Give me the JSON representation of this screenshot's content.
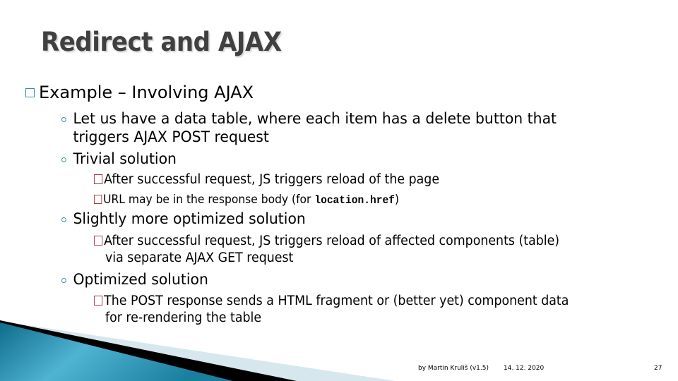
{
  "slide": {
    "title": "Redirect and AJAX",
    "level1": {
      "text": "Example – Involving AJAX"
    },
    "items": {
      "i1": {
        "line1": "Let us have a data table, where each item has a delete button that",
        "line2": "triggers AJAX POST request"
      },
      "i2": {
        "text": "Trivial solution",
        "sub1": "After successful request, JS triggers reload of the page",
        "sub1a_prefix": "URL may be in the response body (for ",
        "sub1a_code": "location.href",
        "sub1a_suffix": ")"
      },
      "i3": {
        "text": "Slightly more optimized solution",
        "sub1_line1": "After successful request, JS triggers reload of affected components (table)",
        "sub1_line2": "via separate AJAX GET request"
      },
      "i4": {
        "text": "Optimized solution",
        "sub1_line1": "The POST response sends a HTML fragment or (better yet) component data",
        "sub1_line2": "for re-rendering the table"
      }
    }
  },
  "footer": {
    "author": "by Martin Kruliš (v1.5)",
    "date": "14. 12. 2020",
    "page": "27"
  },
  "colors": {
    "title": "#404040",
    "bullet_l1": "#3a8ea5",
    "bullet_l3": "#a83a46",
    "deco_teal": "#2a8fad",
    "deco_light": "#d6e8ee"
  }
}
